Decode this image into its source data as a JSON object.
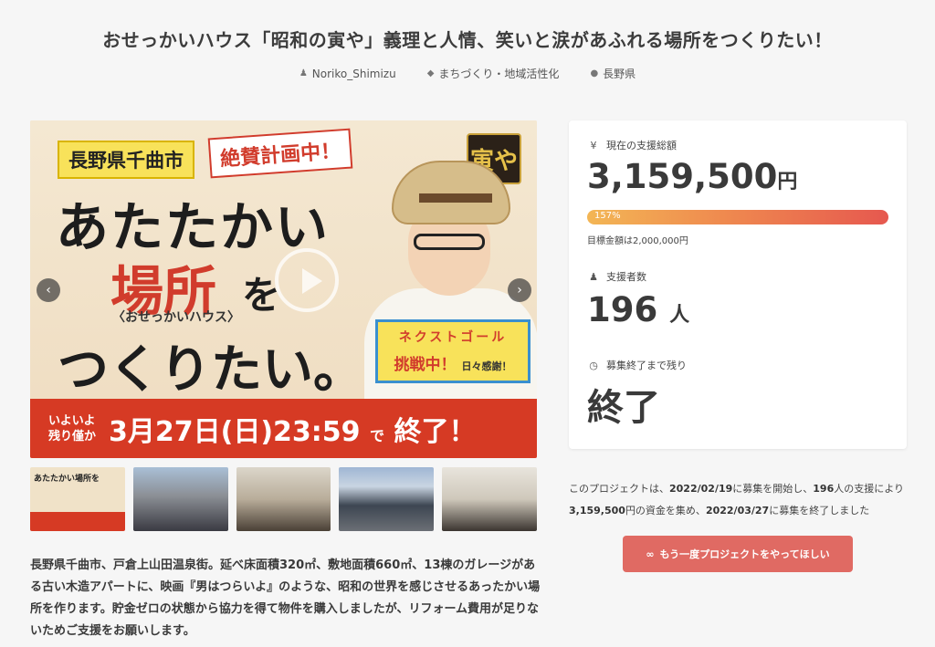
{
  "page": {
    "title": "おせっかいハウス「昭和の寅や」義理と人情、笑いと涙があふれる場所をつくりたい！"
  },
  "meta": {
    "author": "Noriko_Shimizu",
    "category": "まちづくり・地域活性化",
    "location": "長野県",
    "icons": [
      "user-icon",
      "tag-icon",
      "location-pin-icon"
    ]
  },
  "hero": {
    "badge_pref": "長野県千曲市",
    "badge_plan": "絶賛計画中！",
    "seal": "寅や",
    "line1": "あたたかい",
    "line2_red": "場所",
    "line2_black": "を",
    "sub_house": "〈おせっかいハウス〉",
    "line3": "つくりたい。",
    "next_line1": "ネクストゴール",
    "next_line2": "挑戦中！",
    "next_note": "日々感謝！",
    "banner_small1": "いよいよ",
    "banner_small2": "残り僅か",
    "banner_date": "3月27日(日)23:59",
    "banner_de": "で",
    "banner_end": "終了！"
  },
  "thumbs": [
    {
      "label": "あたたかい場所を"
    },
    {
      "label": ""
    },
    {
      "label": ""
    },
    {
      "label": ""
    },
    {
      "label": ""
    }
  ],
  "description": "長野県千曲市、戸倉上山田温泉街。延べ床面積320㎡、敷地面積660㎡、13棟のガレージがある古い木造アパートに、映画『男はつらいよ』のような、昭和の世界を感じさせるあったかい場所を作ります。貯金ゼロの状態から協力を得て物件を購入しましたが、リフォーム費用が足りないためご支援をお願いします。",
  "panel": {
    "total_label": "現在の支援総額",
    "total_value": "3,159,500",
    "total_unit": "円",
    "progress_label": "157%",
    "progress_pct": 157,
    "goal_text": "目標金額は2,000,000円",
    "backers_label": "支援者数",
    "backers_value": "196",
    "backers_unit": "人",
    "remaining_label": "募集終了まで残り",
    "remaining_value": "終了"
  },
  "summary": {
    "p1": "このプロジェクトは、",
    "start": "2022/02/19",
    "p2": "に募集を開始し、",
    "backers": "196",
    "p3": "人の支援により",
    "amount": "3,159,500",
    "p4": "円の資金を集め、",
    "end": "2022/03/27",
    "p5": "に募集を終了しました"
  },
  "cta": {
    "label": "もう一度プロジェクトをやってほしい",
    "icon": "infinity-icon"
  },
  "colors": {
    "accent": "#e06a63",
    "banner_red": "#d63a24",
    "progress_start": "#f3b655",
    "progress_end": "#e6584f"
  }
}
